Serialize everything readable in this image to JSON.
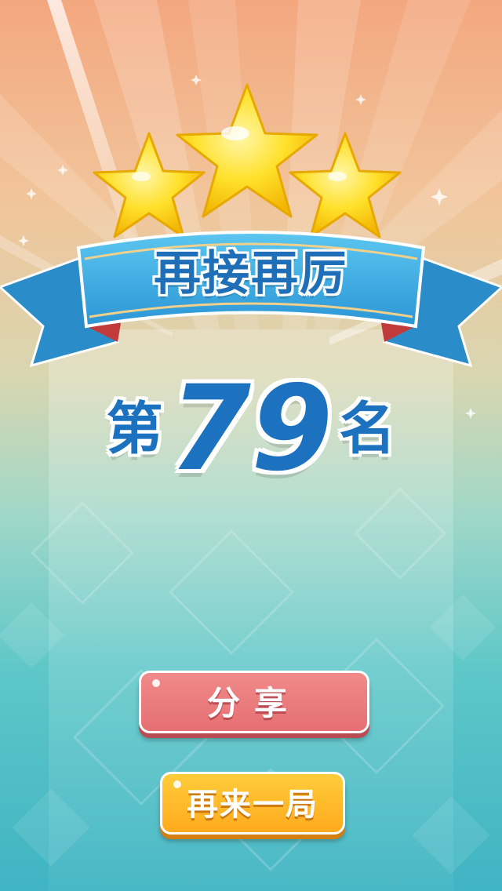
{
  "banner": {
    "title": "再接再厉"
  },
  "result": {
    "prefix": "第",
    "rank": "79",
    "suffix": "名",
    "stars_earned": 3
  },
  "buttons": {
    "share_label": "分享",
    "replay_label": "再来一局"
  },
  "colors": {
    "ribbon": "#3fb3e6",
    "title_text": "#1f6fb8",
    "star": "#ffd623",
    "share_button": "#e56f72",
    "replay_button": "#ffaa1e"
  }
}
